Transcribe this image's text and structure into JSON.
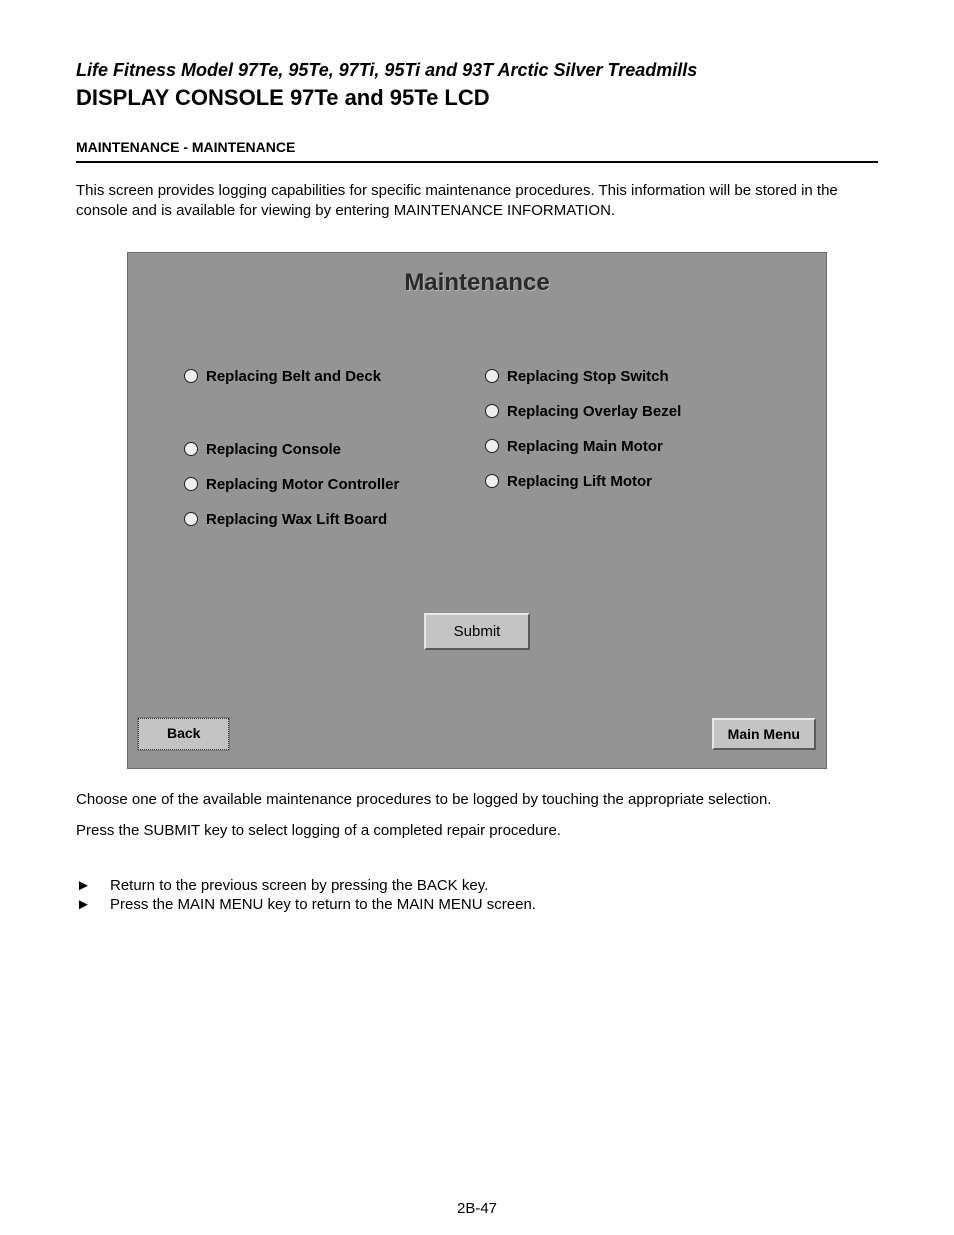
{
  "header": {
    "model_line": "Life Fitness Model 97Te, 95Te, 97Ti, 95Ti and 93T Arctic Silver Treadmills",
    "title": "DISPLAY CONSOLE 97Te and 95Te LCD"
  },
  "section": {
    "label": "MAINTENANCE  - MAINTENANCE"
  },
  "intro": "This screen provides logging capabilities for specific maintenance procedures. This information will be stored in the console and is available for viewing by entering MAINTENANCE INFORMATION.",
  "screen": {
    "title": "Maintenance",
    "left": {
      "opt1": "Replacing Belt and Deck",
      "opt2": "Replacing Console",
      "opt3": "Replacing Motor Controller",
      "opt4": "Replacing Wax Lift Board"
    },
    "right": {
      "opt1": "Replacing Stop Switch",
      "opt2": "Replacing Overlay Bezel",
      "opt3": "Replacing Main Motor",
      "opt4": "Replacing Lift Motor"
    },
    "submit_label": "Submit",
    "back_label": "Back",
    "mainmenu_label": "Main Menu"
  },
  "instructions": {
    "line1": "Choose one of the available maintenance procedures to be logged by touching the appropriate selection.",
    "line2": "Press the SUBMIT key to select logging of a completed repair procedure."
  },
  "bullets": {
    "arrow": "►",
    "b1": "Return to the previous screen by pressing the BACK key.",
    "b2": "Press the MAIN MENU key to return to the MAIN MENU screen."
  },
  "page_number": "2B-47"
}
